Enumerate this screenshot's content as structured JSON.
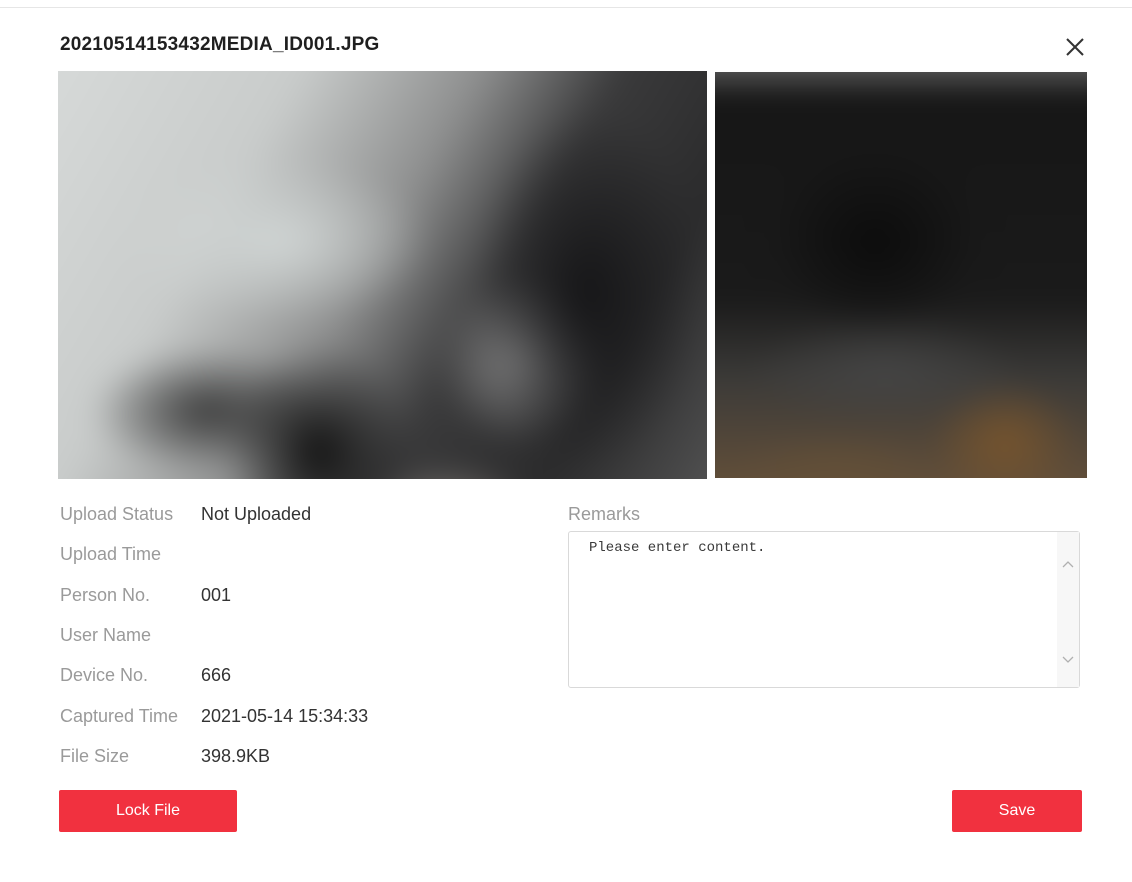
{
  "dialog": {
    "title": "20210514153432MEDIA_ID001.JPG",
    "close_icon": "close-icon"
  },
  "images": {
    "main_photo": "blurred-capture-photo",
    "side_photo": "blurred-face-photo"
  },
  "details": [
    {
      "label": "Upload Status",
      "value": "Not Uploaded"
    },
    {
      "label": "Upload Time",
      "value": ""
    },
    {
      "label": "Person No.",
      "value": "001"
    },
    {
      "label": "User Name",
      "value": ""
    },
    {
      "label": "Device No.",
      "value": "666"
    },
    {
      "label": "Captured Time",
      "value": "2021-05-14 15:34:33"
    },
    {
      "label": "File Size",
      "value": "398.9KB"
    }
  ],
  "remarks": {
    "label": "Remarks",
    "placeholder": "Please enter content.",
    "value": ""
  },
  "buttons": {
    "lock_file": "Lock File",
    "save": "Save"
  },
  "colors": {
    "accent": "#f1313f",
    "label": "#9a9a9a",
    "value": "#333333"
  }
}
